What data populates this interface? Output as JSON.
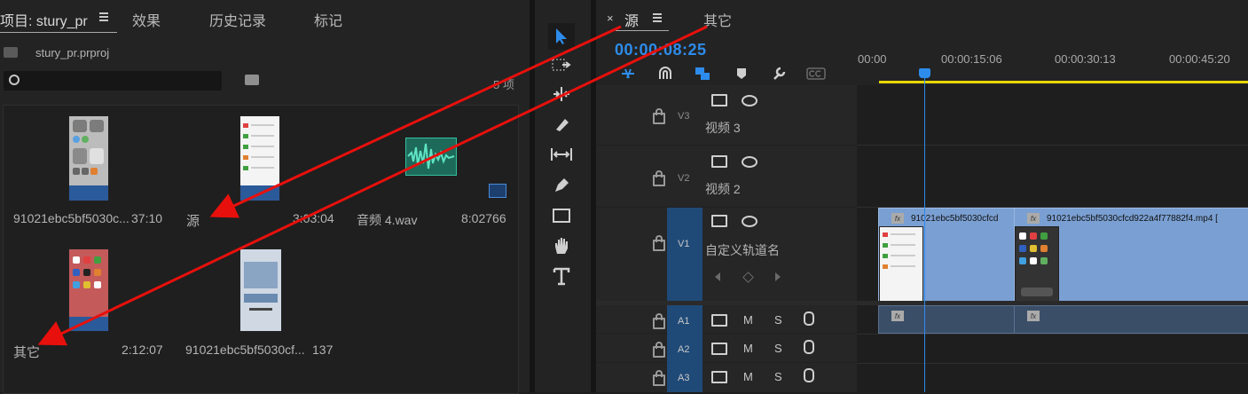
{
  "project_panel": {
    "tabs": [
      {
        "label": "项目: stury_pr"
      },
      {
        "label": "效果"
      },
      {
        "label": "历史记录"
      },
      {
        "label": "标记"
      }
    ],
    "menu_icon": "hamburger-icon",
    "breadcrumb_file": "stury_pr.prproj",
    "item_count": "5 项",
    "items": [
      {
        "name": "91021ebc5bf5030c...",
        "duration": "37:10"
      },
      {
        "name": "源",
        "duration": "3:03:04"
      },
      {
        "name": "音频 4.wav",
        "duration": "8:02766"
      },
      {
        "name": "其它",
        "duration": "2:12:07"
      },
      {
        "name": "91021ebc5bf5030cf...",
        "duration": "137"
      }
    ]
  },
  "timeline": {
    "tabs": [
      {
        "label": "源",
        "close": "×"
      },
      {
        "label": "其它"
      }
    ],
    "timecode": "00:00:08:25",
    "ruler": [
      "00:00",
      "00:00:15:06",
      "00:00:30:13",
      "00:00:45:20"
    ],
    "video_tracks": [
      {
        "id": "V3",
        "name": "视频 3"
      },
      {
        "id": "V2",
        "name": "视频 2"
      },
      {
        "id": "V1",
        "name": "自定义轨道名"
      }
    ],
    "audio_tracks": [
      {
        "id": "A1",
        "m": "M",
        "s": "S"
      },
      {
        "id": "A2",
        "m": "M",
        "s": "S"
      },
      {
        "id": "A3",
        "m": "M",
        "s": "S"
      }
    ],
    "clips": [
      {
        "label": "91021ebc5bf5030cfcd"
      },
      {
        "label": "91021ebc5bf5030cfcd922a4f77882f4.mp4 ["
      }
    ],
    "fx_label": "fx",
    "accent_color": "#2d8ceb",
    "playhead_color": "#2d8ceb",
    "workarea_color": "#e8d800"
  },
  "annotations": {
    "arrow_color": "#e8100c"
  }
}
